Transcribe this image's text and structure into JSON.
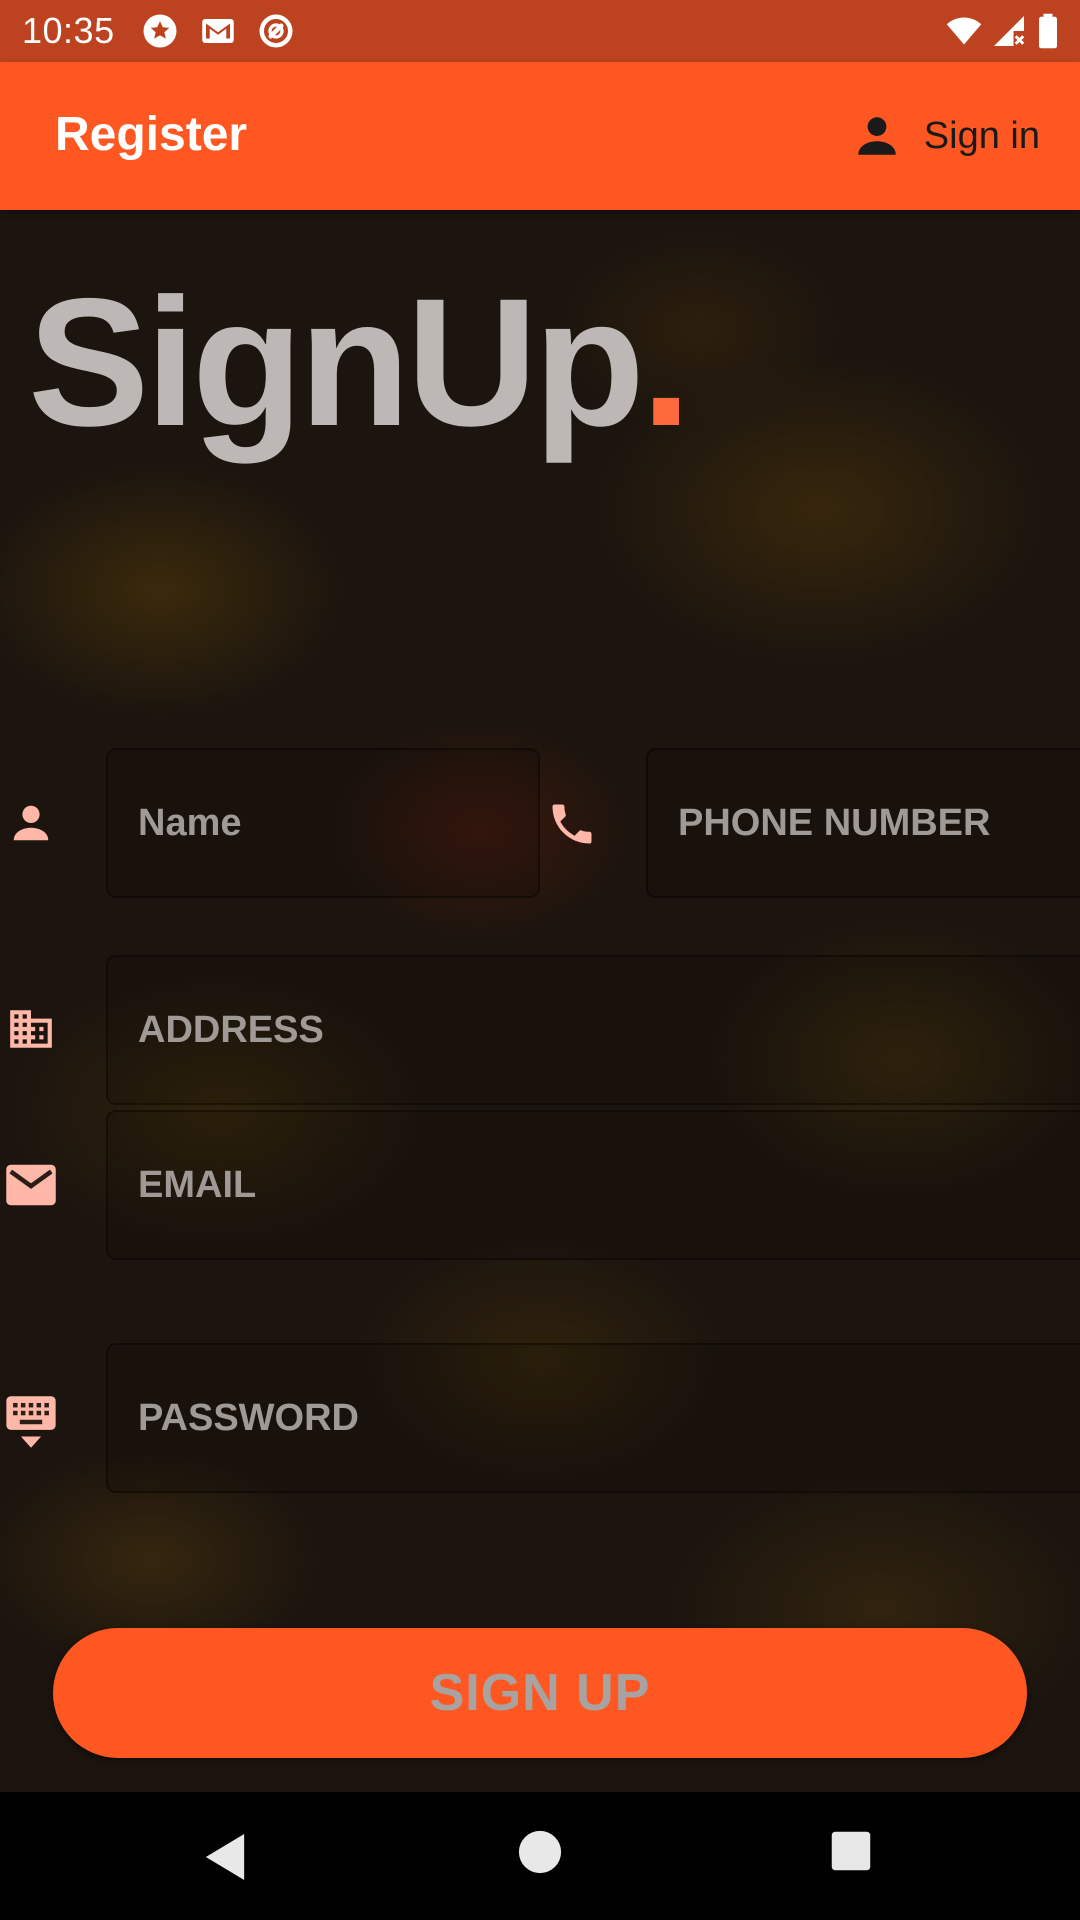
{
  "status_bar": {
    "time": "10:35",
    "left_icons": [
      "star-badge-icon",
      "gmail-icon",
      "do-not-disturb-icon"
    ],
    "right_icons": [
      "wifi-icon",
      "cell-signal-no-data-icon",
      "battery-full-icon"
    ]
  },
  "app_bar": {
    "title": "Register",
    "action_icon": "person-icon",
    "action_label": "Sign in"
  },
  "heading": {
    "text": "SignUp",
    "dot": "."
  },
  "form": {
    "name": {
      "icon": "person-icon",
      "placeholder": "Name",
      "value": ""
    },
    "phone": {
      "icon": "phone-icon",
      "placeholder": "PHONE NUMBER",
      "value": ""
    },
    "address": {
      "icon": "building-icon",
      "placeholder": "ADDRESS",
      "value": ""
    },
    "email": {
      "icon": "mail-icon",
      "placeholder": "EMAIL",
      "value": ""
    },
    "password": {
      "icon": "keyboard-hide-icon",
      "placeholder": "PASSWORD",
      "value": ""
    }
  },
  "signup_button": {
    "label": "SIGN UP"
  },
  "nav_bar": {
    "buttons": [
      "back-icon",
      "home-icon",
      "recents-icon"
    ]
  },
  "colors": {
    "primary": "#ff5722",
    "status_bar": "#bd4220",
    "heading_text": "#bdb8b5",
    "icon_tint": "#ffb8a8",
    "placeholder": "#a09a96"
  }
}
